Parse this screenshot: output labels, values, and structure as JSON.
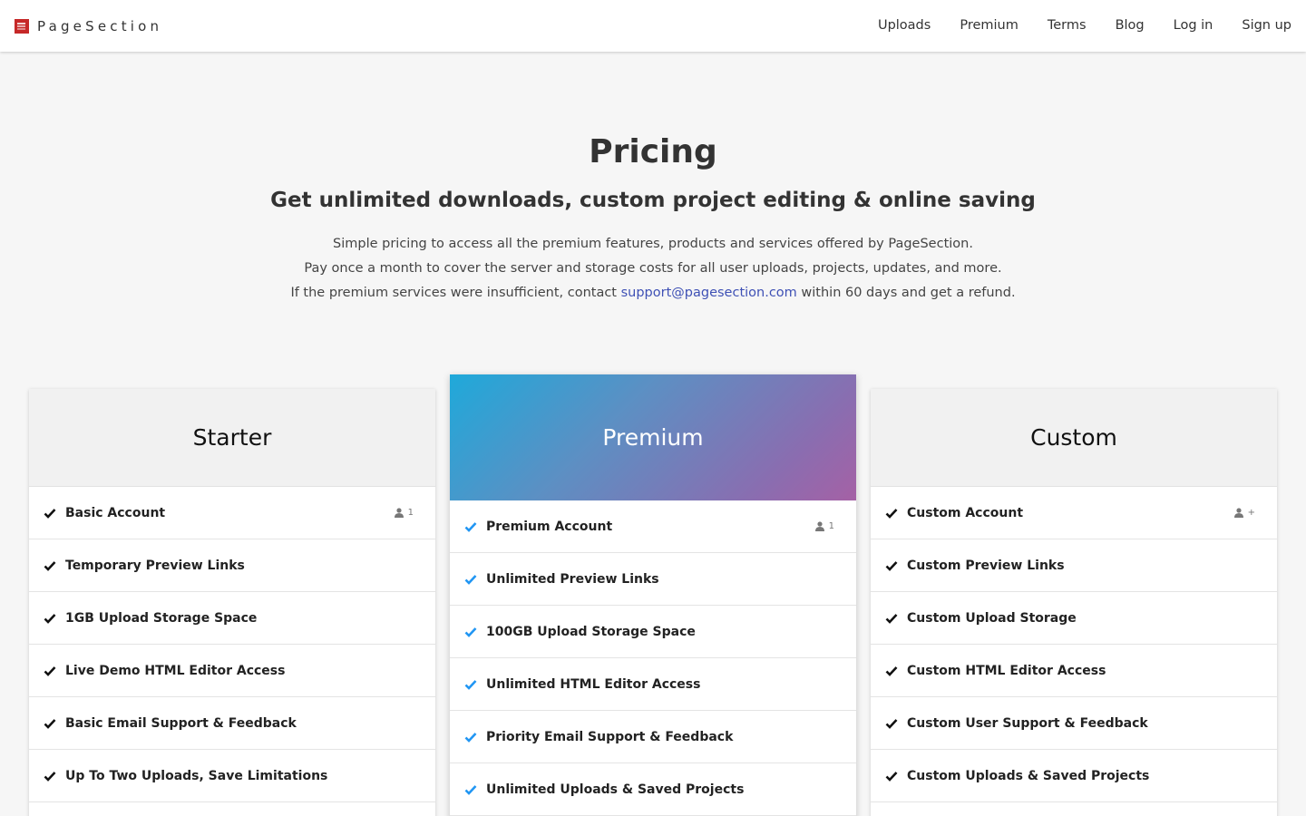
{
  "brand": {
    "name": "PageSection",
    "logo_icon": "pagesection-logo-icon",
    "logo_color": "#c62828"
  },
  "nav": {
    "items": [
      {
        "label": "Uploads"
      },
      {
        "label": "Premium"
      },
      {
        "label": "Terms"
      },
      {
        "label": "Blog"
      },
      {
        "label": "Log in"
      },
      {
        "label": "Sign up"
      }
    ]
  },
  "hero": {
    "title": "Pricing",
    "subtitle": "Get unlimited downloads, custom project editing & online saving",
    "line1": "Simple pricing to access all the premium features, products and services offered by PageSection.",
    "line2": "Pay once a month to cover the server and storage costs for all user uploads, projects, updates, and more.",
    "line3_before": "If the premium services were insufficient, contact ",
    "line3_link": "support@pagesection.com",
    "line3_after": " within 60 days and get a refund."
  },
  "colors": {
    "premium_gradient_start": "#1fa9da",
    "premium_gradient_end": "#a561a5",
    "premium_check": "#2196f3",
    "link": "#3f51b5"
  },
  "plans": [
    {
      "name": "Starter",
      "features": [
        {
          "label": "Basic Account",
          "seats": "1"
        },
        {
          "label": "Temporary Preview Links"
        },
        {
          "label": "1GB Upload Storage Space"
        },
        {
          "label": "Live Demo HTML Editor Access"
        },
        {
          "label": "Basic Email Support & Feedback"
        },
        {
          "label": "Up To Two Uploads, Save Limitations"
        }
      ]
    },
    {
      "name": "Premium",
      "features": [
        {
          "label": "Premium Account",
          "seats": "1"
        },
        {
          "label": "Unlimited Preview Links"
        },
        {
          "label": "100GB Upload Storage Space"
        },
        {
          "label": "Unlimited HTML Editor Access"
        },
        {
          "label": "Priority Email Support & Feedback"
        },
        {
          "label": "Unlimited Uploads & Saved Projects"
        }
      ]
    },
    {
      "name": "Custom",
      "features": [
        {
          "label": "Custom Account",
          "seats": "+"
        },
        {
          "label": "Custom Preview Links"
        },
        {
          "label": "Custom Upload Storage"
        },
        {
          "label": "Custom HTML Editor Access"
        },
        {
          "label": "Custom User Support & Feedback"
        },
        {
          "label": "Custom Uploads & Saved Projects"
        }
      ]
    }
  ]
}
